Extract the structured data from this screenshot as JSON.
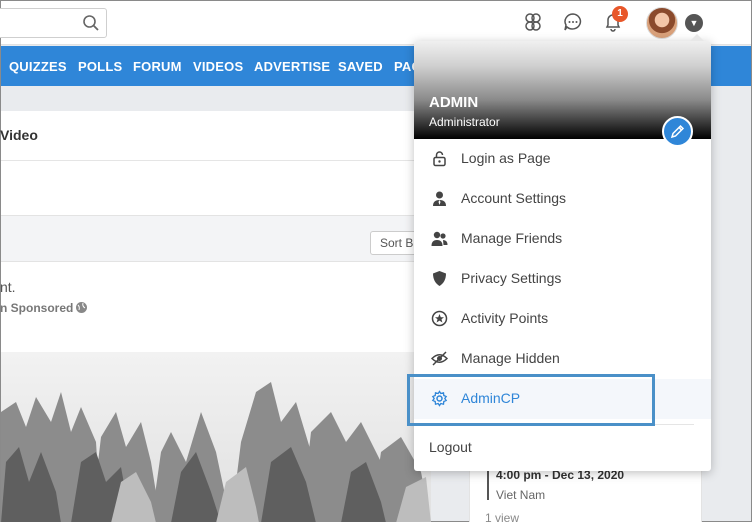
{
  "nav": {
    "items": [
      "QUIZZES",
      "POLLS",
      "FORUM",
      "VIDEOS",
      "ADVERTISE",
      "SAVED",
      "PAG"
    ]
  },
  "notifications": {
    "count": "1"
  },
  "main": {
    "section_title": "Video",
    "sort_label": "Sort B",
    "post_text": "nt.",
    "post_meta": "n Sponsored"
  },
  "event": {
    "time": "4:00 pm - Dec 13, 2020",
    "place": "Viet Nam",
    "views": "1 view"
  },
  "dropdown": {
    "name": "ADMIN",
    "role": "Administrator",
    "items": [
      {
        "label": "Login as Page",
        "icon": "lock-icon"
      },
      {
        "label": "Account Settings",
        "icon": "user-tie-icon"
      },
      {
        "label": "Manage Friends",
        "icon": "user-friends-icon"
      },
      {
        "label": "Privacy Settings",
        "icon": "shield-icon"
      },
      {
        "label": "Activity Points",
        "icon": "star-circle-icon"
      },
      {
        "label": "Manage Hidden",
        "icon": "eye-slash-icon"
      },
      {
        "label": "AdminCP",
        "icon": "gear-icon"
      }
    ],
    "logout": "Logout"
  },
  "colors": {
    "brand_blue": "#2f86d8",
    "badge_orange": "#e8572a",
    "highlight": "#4a90c8"
  }
}
